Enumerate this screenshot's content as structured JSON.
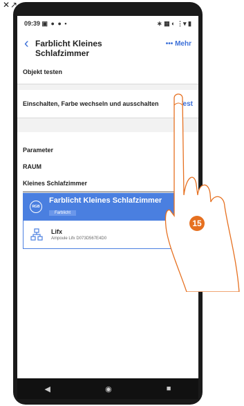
{
  "top_corner": {
    "icons": "✕↗"
  },
  "status": {
    "time": "09:39",
    "left_icons": "▣ ● ● •",
    "right_icons": "∗ ▦ ◐ ⋮▾ ▮"
  },
  "header": {
    "back_icon": "‹",
    "title": "Farblicht Kleines Schlafzimmer",
    "more_label": "Mehr",
    "more_icon": "•••"
  },
  "section_test": {
    "label": "Objekt testen",
    "row_label": "Einschalten, Farbe wechseln und ausschalten",
    "test_link": "Test"
  },
  "parameters": {
    "heading": "Parameter",
    "room_label": "RAUM",
    "room_value": "Kleines Schlafzimmer"
  },
  "card": {
    "icon_text": "RGB",
    "title": "Farblicht Kleines Schlafzimmer",
    "subtitle": "Farblicht",
    "device_name": "Lifx",
    "device_sub": "Ampoule Lifx D073D567E4D0"
  },
  "navbar": {
    "back": "◀",
    "home": "◉",
    "recent": "■"
  },
  "annotation": {
    "step_number": "15"
  },
  "colors": {
    "accent": "#3b6fd8",
    "card": "#4a7fe0",
    "badge": "#e67020"
  }
}
